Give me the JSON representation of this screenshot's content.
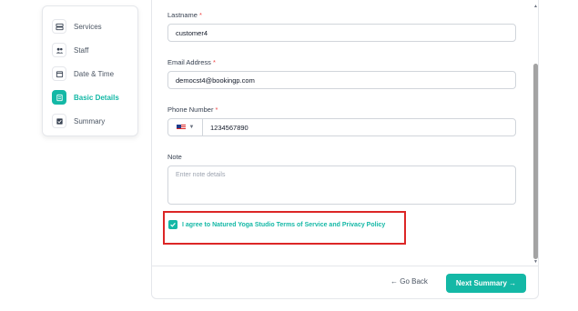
{
  "steps": [
    {
      "label": "Services",
      "icon": "services-icon",
      "active": false
    },
    {
      "label": "Staff",
      "icon": "staff-icon",
      "active": false
    },
    {
      "label": "Date & Time",
      "icon": "calendar-icon",
      "active": false
    },
    {
      "label": "Basic Details",
      "icon": "details-icon",
      "active": true
    },
    {
      "label": "Summary",
      "icon": "summary-icon",
      "active": false
    }
  ],
  "form": {
    "lastname_label": "Lastname",
    "lastname_value": "customer4",
    "email_label": "Email Address",
    "email_value": "democst4@bookingp.com",
    "phone_label": "Phone Number",
    "phone_value": "1234567890",
    "note_label": "Note",
    "note_placeholder": "Enter note details",
    "required_mark": "*",
    "agree_text": "I agree to Natured Yoga Studio Terms of Service and Privacy Policy",
    "agree_checked": true
  },
  "footer": {
    "back_label": "← Go Back",
    "next_label": "Next Summary →"
  },
  "colors": {
    "accent": "#14b8a6",
    "highlight": "#dc2626"
  }
}
